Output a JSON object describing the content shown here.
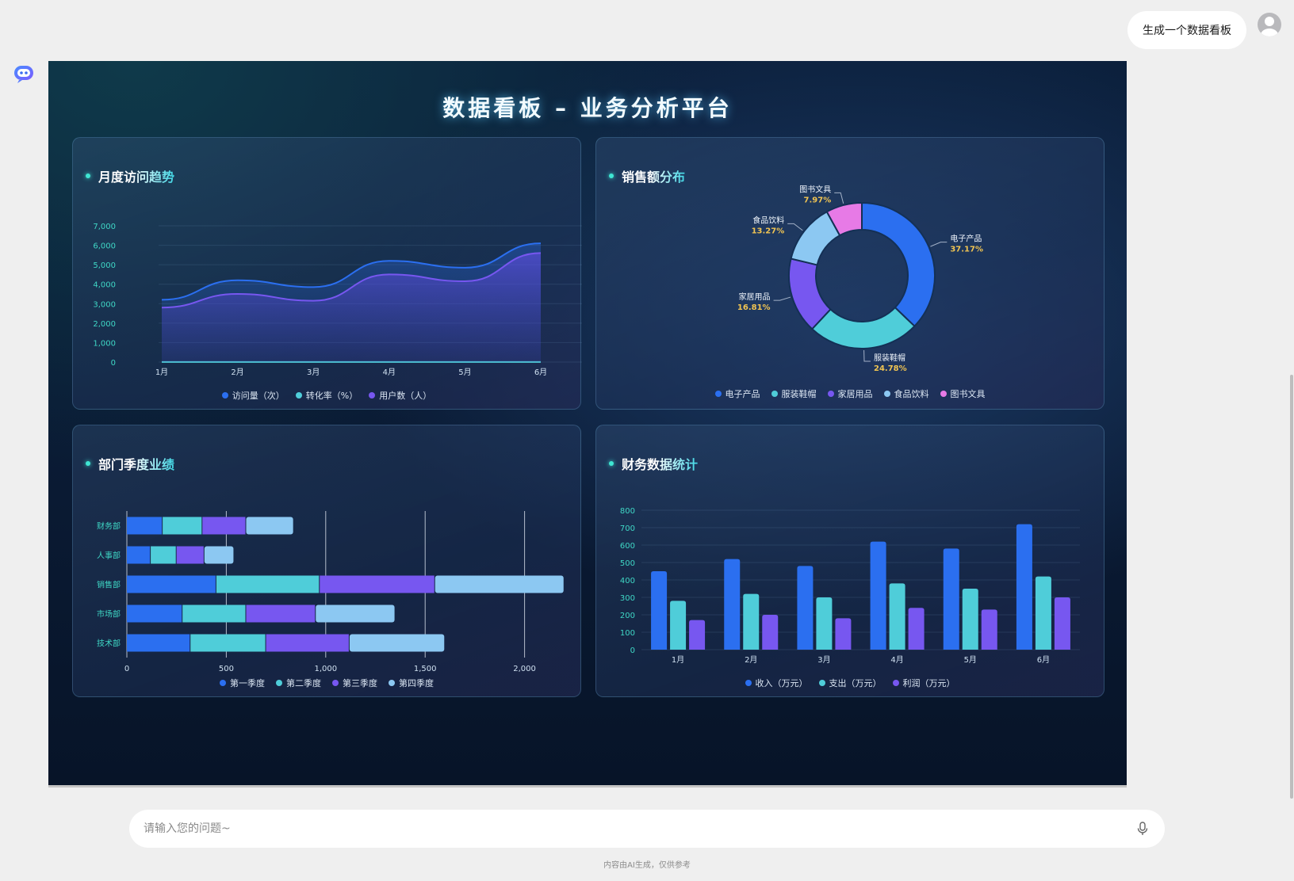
{
  "chat": {
    "user_message": "生成一个数据看板",
    "input_placeholder": "请输入您的问题~",
    "footer_note": "内容由AI生成，仅供参考"
  },
  "dashboard": {
    "title": "数据看板 – 业务分析平台",
    "panels": [
      {
        "title": "月度访问趋势"
      },
      {
        "title": "销售额分布"
      },
      {
        "title": "部门季度业绩"
      },
      {
        "title": "财务数据统计"
      }
    ]
  },
  "colors": {
    "blue": "#2b6ff0",
    "teal": "#4fcdd9",
    "purple": "#7757f0",
    "lightblue": "#8cc8f2",
    "pink": "#e77ae6",
    "axis_text": "#3fd8c6",
    "label_gold": "#f0c452"
  },
  "chart_data": [
    {
      "type": "area",
      "x": [
        "1月",
        "2月",
        "3月",
        "4月",
        "5月",
        "6月"
      ],
      "ylim": [
        0,
        7000
      ],
      "yticks": [
        "0",
        "1,000",
        "2,000",
        "3,000",
        "4,000",
        "5,000",
        "6,000",
        "7,000"
      ],
      "series": [
        {
          "name": "访问量（次）",
          "values": [
            3200,
            4200,
            3850,
            5200,
            4850,
            6100
          ]
        },
        {
          "name": "转化率（%）",
          "values": [
            3.2,
            3.5,
            3.4,
            3.8,
            3.6,
            4.0
          ]
        },
        {
          "name": "用户数（人）",
          "values": [
            2800,
            3500,
            3150,
            4500,
            4150,
            5600
          ]
        }
      ],
      "grid": true,
      "legend": "bottom"
    },
    {
      "type": "pie",
      "donut": true,
      "slices": [
        {
          "name": "电子产品",
          "value": 37.17,
          "label": "37.17%"
        },
        {
          "name": "服装鞋帽",
          "value": 24.78,
          "label": "24.78%"
        },
        {
          "name": "家居用品",
          "value": 16.81,
          "label": "16.81%"
        },
        {
          "name": "食品饮料",
          "value": 13.27,
          "label": "13.27%"
        },
        {
          "name": "图书文具",
          "value": 7.97,
          "label": "7.97%"
        }
      ],
      "legend": "bottom"
    },
    {
      "type": "bar",
      "orientation": "horizontal",
      "stacked": true,
      "categories": [
        "技术部",
        "市场部",
        "销售部",
        "人事部",
        "财务部"
      ],
      "xlim": [
        0,
        2500
      ],
      "xticks": [
        "0",
        "500",
        "1,000",
        "1,500",
        "2,000",
        "2,"
      ],
      "series": [
        {
          "name": "第一季度",
          "values": [
            320,
            280,
            450,
            120,
            180
          ]
        },
        {
          "name": "第二季度",
          "values": [
            380,
            320,
            520,
            130,
            200
          ]
        },
        {
          "name": "第三季度",
          "values": [
            420,
            350,
            580,
            140,
            220
          ]
        },
        {
          "name": "第四季度",
          "values": [
            480,
            400,
            650,
            150,
            240
          ]
        }
      ],
      "grid": true,
      "legend": "bottom"
    },
    {
      "type": "bar",
      "categories": [
        "1月",
        "2月",
        "3月",
        "4月",
        "5月",
        "6月"
      ],
      "ylim": [
        0,
        800
      ],
      "yticks": [
        "0",
        "100",
        "200",
        "300",
        "400",
        "500",
        "600",
        "700",
        "800"
      ],
      "series": [
        {
          "name": "收入（万元）",
          "values": [
            450,
            520,
            480,
            620,
            580,
            720
          ]
        },
        {
          "name": "支出（万元）",
          "values": [
            280,
            320,
            300,
            380,
            350,
            420
          ]
        },
        {
          "name": "利润（万元）",
          "values": [
            170,
            200,
            180,
            240,
            230,
            300
          ]
        }
      ],
      "grid": true,
      "legend": "bottom"
    }
  ]
}
